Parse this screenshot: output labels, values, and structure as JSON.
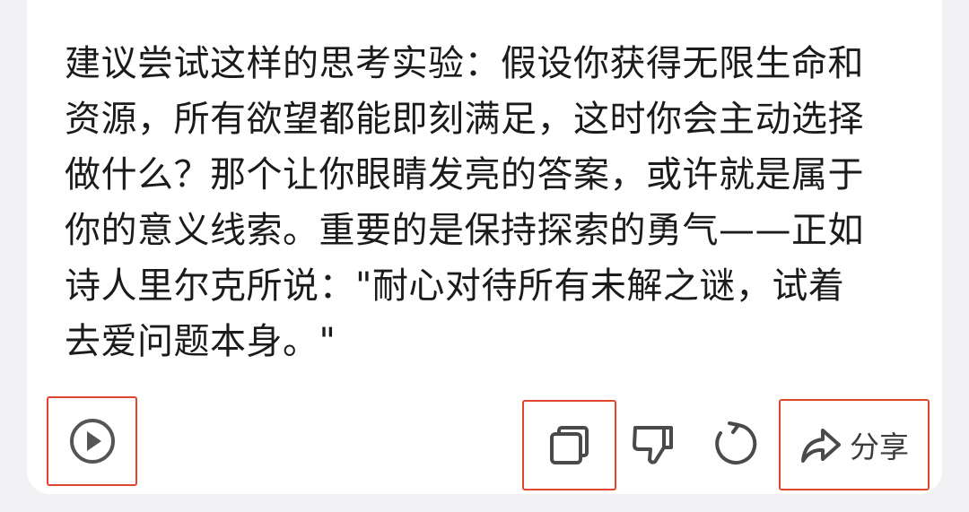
{
  "message": {
    "lines": [
      "建议尝试这样的思考实验：假设你获得无限生命和",
      "资源，所有欲望都能即刻满足，这时你会主动选择",
      "做什么？那个让你眼睛发亮的答案，或许就是属于",
      "你的意义线索。重要的是保持探索的勇气——正如",
      "诗人里尔克所说：\"耐心对待所有未解之谜，试着",
      "去爱问题本身。\""
    ]
  },
  "actions": {
    "play_icon": "play-circle-icon",
    "copy_icon": "copy-icon",
    "dislike_icon": "thumbs-down-icon",
    "refresh_icon": "refresh-icon",
    "share_icon": "share-arrow-icon",
    "share_label": "分享"
  },
  "colors": {
    "highlight": "#e0472e",
    "icon": "#4a4a4a",
    "text": "#1b1b1b"
  }
}
